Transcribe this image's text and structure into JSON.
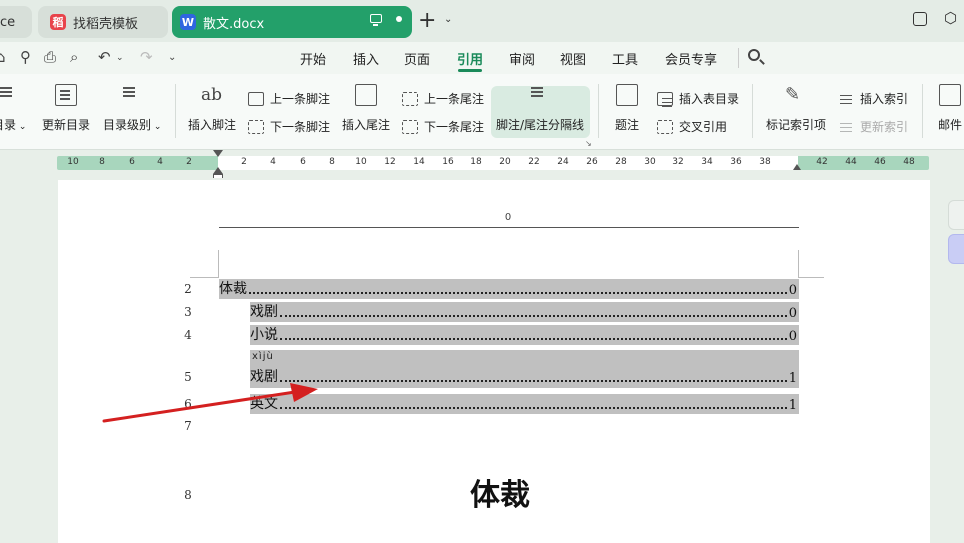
{
  "tabs": [
    {
      "label": "ce"
    },
    {
      "label": "找稻壳模板",
      "logo": "稻"
    },
    {
      "label": "散文.docx",
      "logo": "W"
    }
  ],
  "menu": {
    "items": [
      "开始",
      "插入",
      "页面",
      "引用",
      "审阅",
      "视图",
      "工具",
      "会员专享"
    ],
    "active": "引用"
  },
  "ribbon": {
    "toc": "目录",
    "update_toc": "更新目录",
    "toc_level": "目录级别",
    "insert_footnote": "插入脚注",
    "prev_footnote": "上一条脚注",
    "next_footnote": "下一条脚注",
    "insert_endnote": "插入尾注",
    "prev_endnote": "上一条尾注",
    "next_endnote": "下一条尾注",
    "separator": "脚注/尾注分隔线",
    "caption": "题注",
    "insert_table_of_figures": "插入表目录",
    "cross_reference": "交叉引用",
    "mark_index_entry": "标记索引项",
    "insert_index": "插入索引",
    "update_index": "更新索引",
    "mail": "邮件",
    "footnote_icon_text": "ab"
  },
  "ruler": {
    "left_numbers": [
      "10",
      "8",
      "6",
      "4",
      "2"
    ],
    "right_numbers": [
      "2",
      "4",
      "6",
      "8",
      "10",
      "12",
      "14",
      "16",
      "18",
      "20",
      "22",
      "24",
      "26",
      "28",
      "30",
      "32",
      "34",
      "36",
      "38",
      "42",
      "44",
      "46",
      "48"
    ]
  },
  "document": {
    "header_number": "0",
    "line_numbers": [
      "2",
      "3",
      "4",
      "5",
      "6",
      "7",
      "8"
    ],
    "toc_entries": [
      {
        "label": "体裁",
        "page": "0"
      },
      {
        "label": "戏剧",
        "page": "0"
      },
      {
        "label": "小说",
        "page": "0"
      },
      {
        "label": "戏剧",
        "page": "1",
        "ruby": "xìjù"
      },
      {
        "label": "英文",
        "page": "1"
      }
    ],
    "heading": "体裁"
  },
  "colors": {
    "accent": "#23a06a",
    "active_text": "#1a8a5a",
    "ruler": "#a8d6bd",
    "toc_highlight": "#c0c0c0",
    "arrow": "#d42020"
  }
}
